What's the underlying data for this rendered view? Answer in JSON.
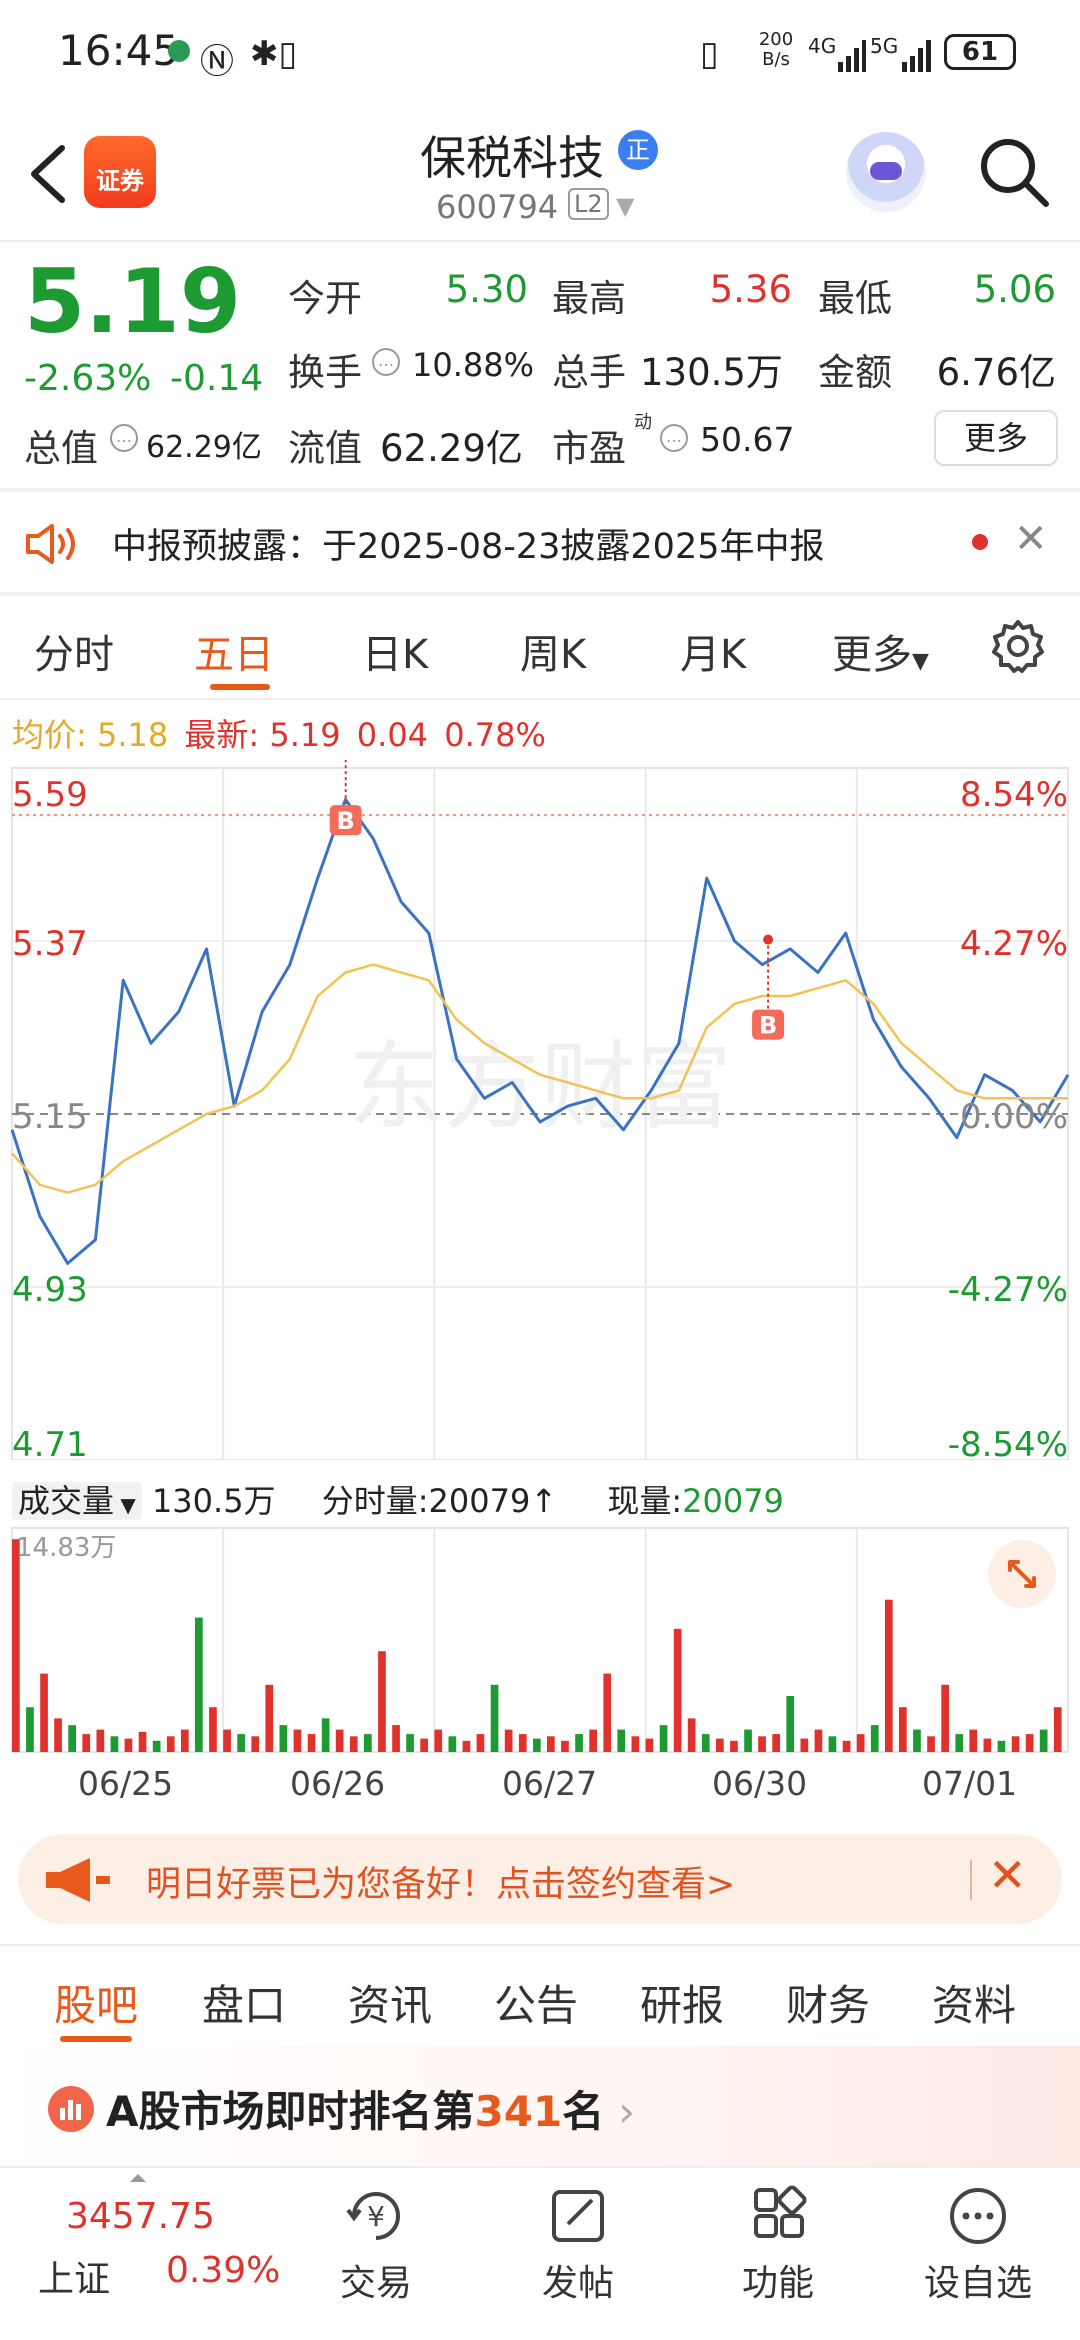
{
  "status_bar": {
    "time": "16:45",
    "net_speed": "200\nB/s",
    "net_speed_top": "200",
    "net_speed_bottom": "B/s",
    "net_4g": "4G",
    "net_5g": "5G",
    "battery": "61"
  },
  "header": {
    "stock_name": "保税科技",
    "badge": "正",
    "stock_code": "600794",
    "level_badge": "L2",
    "logo_text": "证券"
  },
  "quote": {
    "price": "5.19",
    "change_pct": "-2.63%",
    "change_abs": "-0.14",
    "open_label": "今开",
    "open": "5.30",
    "high_label": "最高",
    "high": "5.36",
    "low_label": "最低",
    "low": "5.06",
    "turnover_label": "换手",
    "turnover": "10.88%",
    "volume_label": "总手",
    "volume": "130.5万",
    "amount_label": "金额",
    "amount": "6.76亿",
    "mktcap_label": "总值",
    "mktcap": "62.29亿",
    "float_label": "流值",
    "float_cap": "62.29亿",
    "pe_label": "市盈",
    "pe_sup": "动",
    "pe": "50.67",
    "more_label": "更多"
  },
  "announcement": {
    "text": "中报预披露：于2025-08-23披露2025年中报"
  },
  "chart_tabs": {
    "tabs": [
      "分时",
      "五日",
      "日K",
      "周K",
      "月K",
      "更多"
    ],
    "active": 1
  },
  "avg_line": {
    "avg_label": "均价:",
    "avg": "5.18",
    "latest_label": "最新:",
    "latest": "5.19",
    "chg": "0.04",
    "pct": "0.78%"
  },
  "chart_data": {
    "type": "line",
    "title": "",
    "y_left_ticks": [
      "5.59",
      "5.37",
      "5.15",
      "4.93",
      "4.71"
    ],
    "y_right_ticks": [
      "8.54%",
      "4.27%",
      "0.00%",
      "-4.27%",
      "-8.54%"
    ],
    "ylim": [
      4.71,
      5.59
    ],
    "prev_close": 5.15,
    "x_dates": [
      "06/25",
      "06/26",
      "06/27",
      "06/30",
      "07/01"
    ],
    "watermark": "东方财富",
    "buy_markers": [
      {
        "label": "B",
        "day": "06/26",
        "price": 5.53
      },
      {
        "label": "B",
        "day": "06/30",
        "price": 5.27
      }
    ],
    "series": [
      {
        "name": "price",
        "color": "#3a72c4",
        "values": [
          5.13,
          5.02,
          4.96,
          4.99,
          5.32,
          5.24,
          5.28,
          5.36,
          5.16,
          5.28,
          5.34,
          5.45,
          5.55,
          5.5,
          5.42,
          5.38,
          5.22,
          5.17,
          5.19,
          5.14,
          5.16,
          5.17,
          5.13,
          5.18,
          5.24,
          5.45,
          5.37,
          5.34,
          5.36,
          5.33,
          5.38,
          5.27,
          5.21,
          5.17,
          5.12,
          5.2,
          5.18,
          5.14,
          5.2
        ]
      },
      {
        "name": "avg",
        "color": "#f2c254",
        "values": [
          5.1,
          5.06,
          5.05,
          5.06,
          5.09,
          5.11,
          5.13,
          5.15,
          5.16,
          5.18,
          5.22,
          5.3,
          5.33,
          5.34,
          5.33,
          5.32,
          5.27,
          5.24,
          5.22,
          5.2,
          5.19,
          5.18,
          5.17,
          5.17,
          5.18,
          5.26,
          5.29,
          5.3,
          5.3,
          5.31,
          5.32,
          5.29,
          5.24,
          5.21,
          5.18,
          5.17,
          5.17,
          5.17,
          5.17
        ]
      }
    ]
  },
  "volume": {
    "label": "成交量",
    "total": "130.5万",
    "minute_label": "分时量:",
    "minute": "20079",
    "arrow": "↑",
    "now_label": "现量:",
    "now": "20079",
    "max_label": "14.83万",
    "bars": [
      0.95,
      0.2,
      0.35,
      0.15,
      0.12,
      0.08,
      0.1,
      0.07,
      0.06,
      0.09,
      0.05,
      0.07,
      0.1,
      0.6,
      0.2,
      0.1,
      0.08,
      0.07,
      0.3,
      0.12,
      0.1,
      0.08,
      0.15,
      0.1,
      0.07,
      0.08,
      0.45,
      0.12,
      0.08,
      0.06,
      0.1,
      0.07,
      0.05,
      0.08,
      0.3,
      0.1,
      0.08,
      0.06,
      0.07,
      0.05,
      0.08,
      0.1,
      0.35,
      0.1,
      0.07,
      0.06,
      0.12,
      0.55,
      0.15,
      0.08,
      0.06,
      0.05,
      0.1,
      0.07,
      0.08,
      0.25,
      0.06,
      0.1,
      0.07,
      0.05,
      0.08,
      0.12,
      0.68,
      0.2,
      0.1,
      0.07,
      0.3,
      0.08,
      0.1,
      0.06,
      0.05,
      0.07,
      0.08,
      0.1,
      0.2
    ]
  },
  "promo": {
    "text": "明日好票已为您备好！点击签约查看>"
  },
  "info_tabs": {
    "tabs": [
      "股吧",
      "盘口",
      "资讯",
      "公告",
      "研报",
      "财务",
      "资料"
    ],
    "active": 0
  },
  "ranking": {
    "prefix": "A股市场即时排名第",
    "rank": "341",
    "suffix": "名"
  },
  "bottom_nav": {
    "index_value": "3457.75",
    "index_name": "上证",
    "index_pct": "0.39%",
    "items": [
      {
        "label": "交易",
        "icon": "yen-icon"
      },
      {
        "label": "发帖",
        "icon": "edit-icon"
      },
      {
        "label": "功能",
        "icon": "grid-icon"
      },
      {
        "label": "设自选",
        "icon": "more-icon"
      }
    ]
  }
}
